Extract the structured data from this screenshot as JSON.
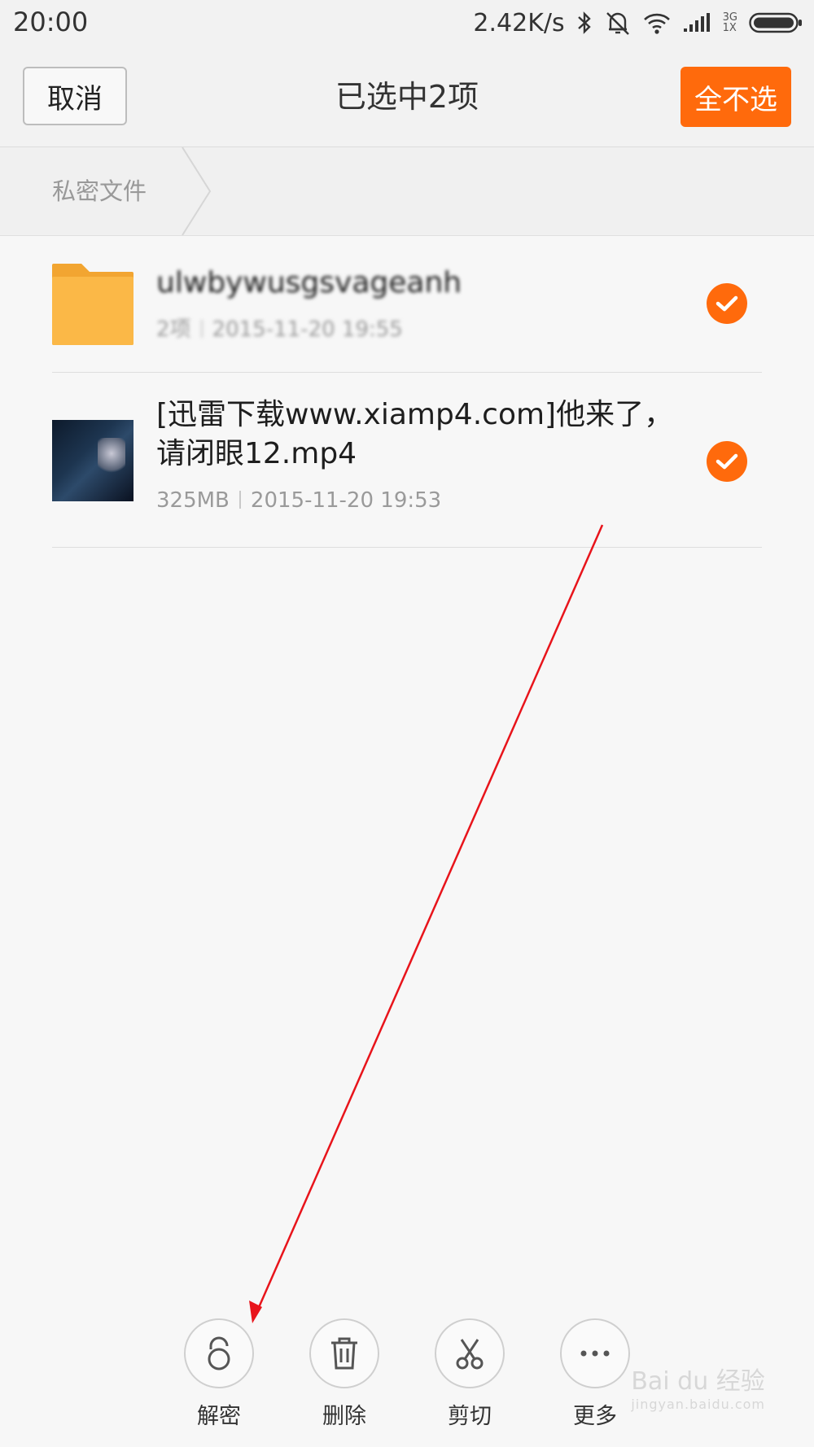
{
  "status_bar": {
    "time": "20:00",
    "speed": "2.42K/s",
    "network_top": "3G",
    "network_bottom": "1X"
  },
  "header": {
    "cancel_label": "取消",
    "title": "已选中2项",
    "deselect_all_label": "全不选"
  },
  "breadcrumb": {
    "label": "私密文件"
  },
  "items": [
    {
      "name": "ulwbywusgsvageanh",
      "meta_count": "2项",
      "meta_date": "2015-11-20 19:55",
      "selected": true,
      "icon": "folder-icon"
    },
    {
      "name_line1": "[迅雷下载www.xiamp4.com]他来了，",
      "name_line2": "请闭眼12.mp4",
      "meta_size": "325MB",
      "meta_date": "2015-11-20 19:53",
      "selected": true,
      "icon": "video-thumbnail"
    }
  ],
  "actions": [
    {
      "label": "解密",
      "icon": "unlock-icon"
    },
    {
      "label": "删除",
      "icon": "trash-icon"
    },
    {
      "label": "剪切",
      "icon": "scissors-icon"
    },
    {
      "label": "更多",
      "icon": "more-icon"
    }
  ],
  "watermark": {
    "brand": "Bai du 经验",
    "url": "jingyan.baidu.com"
  },
  "colors": {
    "accent": "#ff6a0c",
    "folder": "#fbb847",
    "annotation": "#e8141b"
  }
}
